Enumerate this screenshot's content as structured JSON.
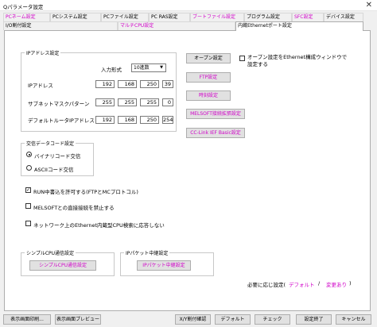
{
  "window": {
    "title": "Qパラメータ設定",
    "close_glyph": "✕"
  },
  "tabs_row1": [
    {
      "label": "PCネーム設定",
      "pink": true
    },
    {
      "label": "PCシステム設定",
      "pink": false
    },
    {
      "label": "PCファイル設定",
      "pink": false
    },
    {
      "label": "PC RAS設定",
      "pink": false
    },
    {
      "label": "ブートファイル設定",
      "pink": true
    },
    {
      "label": "プログラム設定",
      "pink": false
    },
    {
      "label": "SFC設定",
      "pink": true
    },
    {
      "label": "デバイス設定",
      "pink": false
    }
  ],
  "tabs_row2": [
    {
      "label": "I/O割付設定",
      "pink": false,
      "active": false
    },
    {
      "label": "マルチCPU設定",
      "pink": true,
      "active": false
    },
    {
      "label": "内蔵Ethernetポート設定",
      "pink": false,
      "active": true
    }
  ],
  "ip_group": {
    "title": "IPアドレス設定",
    "input_format_label": "入力形式",
    "input_format_value": "10進数",
    "ip_label": "IPアドレス",
    "ip": [
      "192",
      "168",
      "250",
      "39"
    ],
    "subnet_label": "サブネットマスクパターン",
    "subnet": [
      "255",
      "255",
      "255",
      "0"
    ],
    "gateway_label": "デフォルトルータIPアドレス",
    "gateway": [
      "192",
      "168",
      "250",
      "254"
    ]
  },
  "code_group": {
    "title": "交信データコード設定",
    "binary": "バイナリコード交信",
    "ascii": "ASCIIコード交信"
  },
  "checks": {
    "run_write": "RUN中書込を許可する(FTPとMCプロトコル)",
    "melsoft_direct": "MELSOFTとの直接接続を禁止する",
    "no_response": "ネットワーク上のEthernet内蔵型CPU検索に応答しない",
    "open_setting_window": "オープン設定をEthernet構成ウィンドウで",
    "open_setting_window_2": "設定する",
    "check_mark": "✓"
  },
  "side_buttons": {
    "open": "オープン設定",
    "ftp": "FTP設定",
    "time": "時刻設定",
    "melsoft": "MELSOFT接続拡張設定",
    "cclink": "CC-Link IEF Basic設定"
  },
  "simple_cpu": {
    "title": "シンプルCPU通信設定",
    "button": "シンプルCPU通信設定"
  },
  "ip_packet": {
    "title": "IPパケット中継設定",
    "button": "IPパケット中継設定"
  },
  "required": {
    "label": "必要に応じ設定(",
    "default": "デフォルト",
    "sep": "/",
    "changed": "変更あり",
    "close": ")"
  },
  "bottom_buttons": {
    "print_form": "表示画面印刷...",
    "preview": "表示画面プレビュー",
    "xy_check": "X/Y割付確認",
    "default": "デフォルト",
    "check": "チェック",
    "finish": "設定終了",
    "cancel": "キャンセル"
  },
  "colors": {
    "accent_pink": "#d000c8",
    "panel_bg": "#ffffff",
    "window_bg": "#f0f0f0"
  }
}
